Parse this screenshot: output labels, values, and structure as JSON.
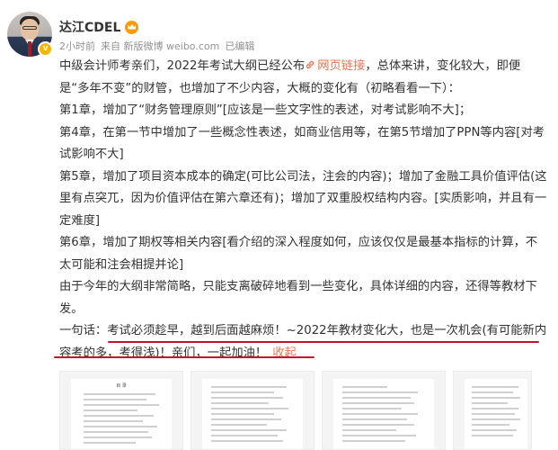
{
  "user": {
    "name": "达江CDEL",
    "avatar_icon": "avatar-photo",
    "verified_icon": "v-badge",
    "member_icon": "vip-crown-icon"
  },
  "meta": {
    "time": "2小时前",
    "source": "来自 新版微博 weibo.com",
    "edited": "已编辑"
  },
  "post": {
    "line1_text": "中级会计师考亲们，2022年考试大纲已经公布",
    "link_label": "网页链接",
    "line1_rest": "，总体来讲，变化较大，即便是“多年不变”的财管，也增加了不少内容，大概的变化有（初略看看一下）：",
    "ch1": "第1章，增加了“财务管理原则”[应该是一些文字性的表述，对考试影响不大]；",
    "ch4": "第4章，在第一节中增加了一些概念性表述，如商业信用等，在第5节增加了PPN等内容[对考试影响不大]",
    "ch5": "第5章，增加了项目资本成本的确定(可比公司法，注会的内容)；增加了金融工具价值评估(这里有点突兀，因为价值评估在第六章还有)；增加了双重股权结构内容。[实质影响，并且有一定难度]",
    "ch6": "第6章，增加了期权等相关内容[看介绍的深入程度如何，应该仅仅是最基本指标的计算，不太可能和注会相提并论]",
    "summary": "由于今年的大纲非常简略，只能支离破碎地看到一些变化，具体详细的内容，还得等教材下发。",
    "oneline_label": "一句话：",
    "oneline_text": "考试必须趁早，越到后面越麻烦！~2022年教材变化大，也是一次机会(有可能新内容考的多，考得浅)！亲们，一起加油！",
    "collapse_label": "收起"
  },
  "thumbnails": [
    {
      "title": "目 录",
      "name": "thumbnail-1"
    },
    {
      "title": "",
      "name": "thumbnail-2"
    },
    {
      "title": "",
      "name": "thumbnail-3"
    },
    {
      "title": "",
      "name": "thumbnail-4"
    }
  ],
  "colors": {
    "link": "#eb7350",
    "annotation_red": "#c8102e",
    "meta_gray": "#939393"
  }
}
